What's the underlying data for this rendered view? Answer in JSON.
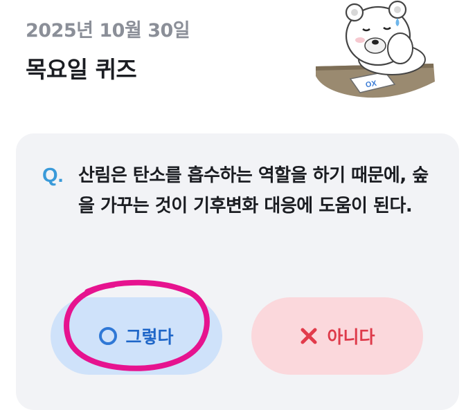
{
  "header": {
    "date": "2025년 10월 30일",
    "title": "목요일 퀴즈"
  },
  "illustration": {
    "name": "polar-bear-sweating-icon",
    "paper_text": "OX"
  },
  "quiz": {
    "q_mark": "Q.",
    "question": "산림은 탄소를 흡수하는 역할을 하기 때문에, 숲을 가꾸는 것이 기후변화 대응에 도움이 된다.",
    "answers": [
      {
        "label": "그렇다",
        "icon": "circle-o-icon"
      },
      {
        "label": "아니다",
        "icon": "x-mark-icon"
      }
    ]
  },
  "colors": {
    "accent_blue": "#3a9ad9",
    "yes_bg": "#cfe2fa",
    "no_bg": "#fbd8dc",
    "annotation": "#e6138f"
  }
}
